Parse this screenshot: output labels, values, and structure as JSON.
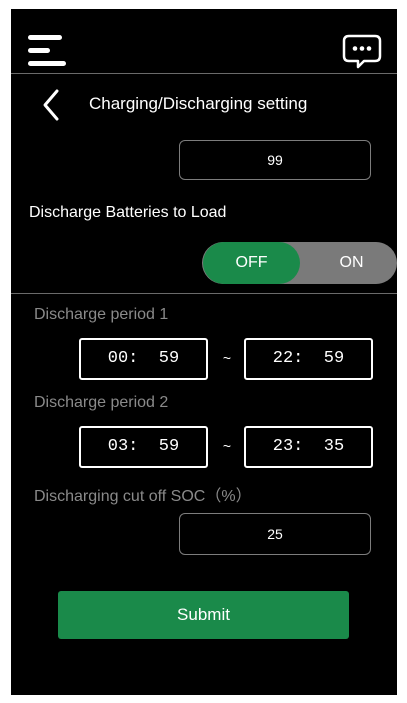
{
  "header": {
    "title": "Charging/Discharging setting"
  },
  "top_field": {
    "value": "99"
  },
  "discharge_to_load": {
    "label": "Discharge Batteries to Load",
    "toggle_off_label": "OFF",
    "toggle_on_label": "ON",
    "selected": "OFF"
  },
  "period1": {
    "label": "Discharge period 1",
    "start": "00:  59",
    "separator": "~",
    "end": "22:  59"
  },
  "period2": {
    "label": "Discharge period 2",
    "start": "03:  59",
    "separator": "~",
    "end": "23:  35"
  },
  "cutoff": {
    "label": "Discharging cut off SOC（%）",
    "value": "25"
  },
  "submit_label": "Submit",
  "colors": {
    "screen_background": "#000000",
    "accent_green": "#1a8a4a",
    "toggle_track": "#7a7a7a",
    "muted_label": "#8a8a8a"
  },
  "icons": {
    "menu": "hamburger-menu-icon",
    "chat": "chat-bubble-icon",
    "back": "chevron-left-icon"
  }
}
